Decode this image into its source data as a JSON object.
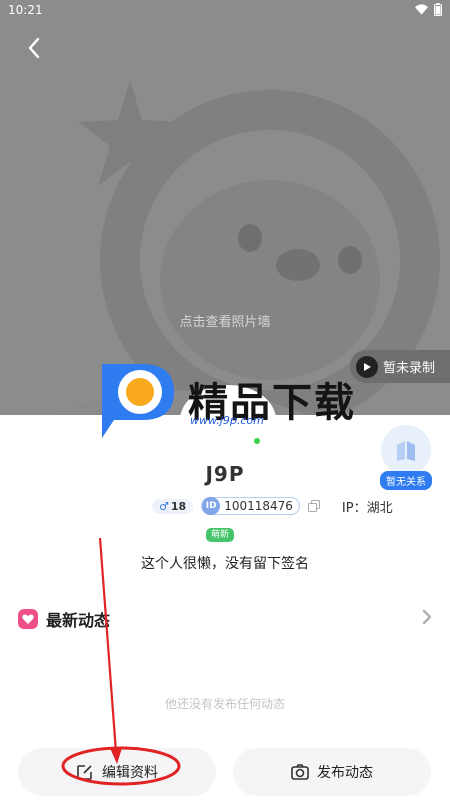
{
  "status_bar": {
    "time": "10:21"
  },
  "header": {
    "photo_wall_hint": "点击查看照片墙",
    "record_label": "暂未录制"
  },
  "watermark": {
    "title": "精品下载",
    "url": "www.j9p.com"
  },
  "relation": {
    "label": "暂无关系"
  },
  "profile": {
    "nickname": "J9P",
    "gender_symbol": "♂",
    "age": "18",
    "id_tag": "ID",
    "id_value": "100118476",
    "ip": "IP：湖北",
    "tag": "萌新",
    "signature": "这个人很懒，没有留下签名"
  },
  "moments": {
    "title": "最新动态",
    "empty_hint": "他还没有发布任何动态"
  },
  "actions": {
    "edit_label": "编辑资料",
    "post_label": "发布动态"
  },
  "colors": {
    "header_bg": "#8c8c8c",
    "accent_blue": "#2f7cf0",
    "accent_pink": "#f0508a",
    "online_green": "#3ccf4e",
    "annotation_red": "#e02424"
  }
}
